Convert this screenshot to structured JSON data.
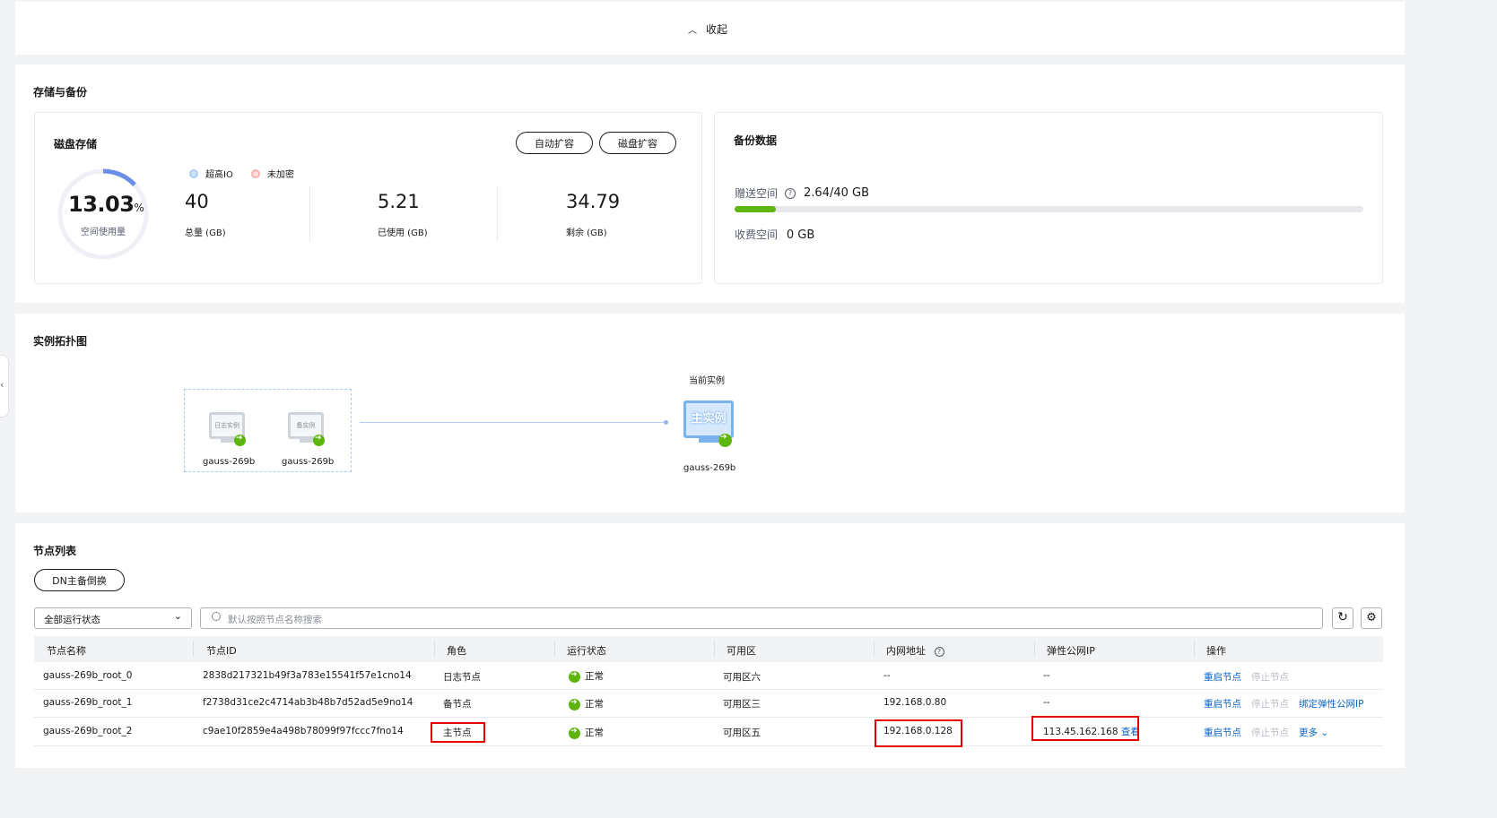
{
  "collapse_label": "收起",
  "storage": {
    "section_title": "存储与备份",
    "disk": {
      "title": "磁盘存储",
      "auto_expand": "自动扩容",
      "disk_expand": "磁盘扩容",
      "usage_value": "13.03",
      "usage_unit": "%",
      "usage_label": "空间使用量",
      "usage_fraction": 0.1303,
      "legend_io": "超高IO",
      "legend_encrypt": "未加密",
      "total_value": "40",
      "total_label": "总量 (GB)",
      "used_value": "5.21",
      "used_label": "已使用 (GB)",
      "remaining_value": "34.79",
      "remaining_label": "剩余 (GB)"
    },
    "backup": {
      "title": "备份数据",
      "free_label": "赠送空间",
      "free_value": "2.64/40 GB",
      "free_fraction": 0.066,
      "paid_label": "收费空间",
      "paid_value": "0 GB"
    }
  },
  "topology": {
    "title": "实例拓扑图",
    "current_label": "当前实例",
    "log_node_tag": "日志实例",
    "log_node_name": "gauss-269b",
    "standby_node_tag": "备实例",
    "standby_node_name": "gauss-269b",
    "primary_node_tag": "主实例",
    "primary_node_name": "gauss-269b"
  },
  "nodes": {
    "title": "节点列表",
    "switch_button": "DN主备倒换",
    "filter_value": "全部运行状态",
    "search_placeholder": "默认按照节点名称搜索",
    "headers": [
      "节点名称",
      "节点ID",
      "角色",
      "运行状态",
      "可用区",
      "内网地址",
      "弹性公网IP",
      "操作"
    ],
    "rows": [
      {
        "name": "gauss-269b_root_0",
        "id": "2838d217321b49f3a783e15541f57e1cno14",
        "role": "日志节点",
        "status": "正常",
        "az": "可用区六",
        "ip": "--",
        "eip": "--",
        "eip_link": "",
        "op1": "重启节点",
        "op2": "停止节点",
        "op3": ""
      },
      {
        "name": "gauss-269b_root_1",
        "id": "f2738d31ce2c4714ab3b48b7d52ad5e9no14",
        "role": "备节点",
        "status": "正常",
        "az": "可用区三",
        "ip": "192.168.0.80",
        "eip": "--",
        "eip_link": "",
        "op1": "重启节点",
        "op2": "停止节点",
        "op3": "绑定弹性公网IP"
      },
      {
        "name": "gauss-269b_root_2",
        "id": "c9ae10f2859e4a498b78099f97fccc7fno14",
        "role": "主节点",
        "status": "正常",
        "az": "可用区五",
        "ip": "192.168.0.128",
        "eip": "113.45.162.168",
        "eip_link": "查看",
        "op1": "重启节点",
        "op2": "停止节点",
        "op3": "更多"
      }
    ]
  }
}
